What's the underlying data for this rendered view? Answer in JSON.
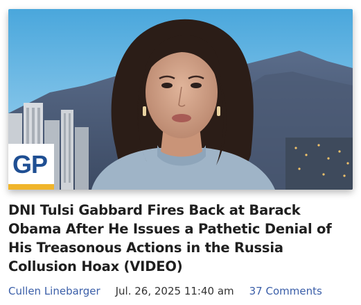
{
  "article": {
    "badge_text": "GP",
    "headline": "DNI Tulsi Gabbard Fires Back at Barack Obama After He Issues a Pathetic Denial of His Treasonous Actions in the Russia Collusion Hoax (VIDEO)",
    "author": "Cullen Linebarger",
    "date": "Jul. 26, 2025 11:40 am",
    "comments": "37 Comments"
  },
  "colors": {
    "link": "#3a5ea8",
    "badge_blue": "#1f4f93",
    "badge_gold": "#f0b52b",
    "headline": "#1f1f1f"
  }
}
